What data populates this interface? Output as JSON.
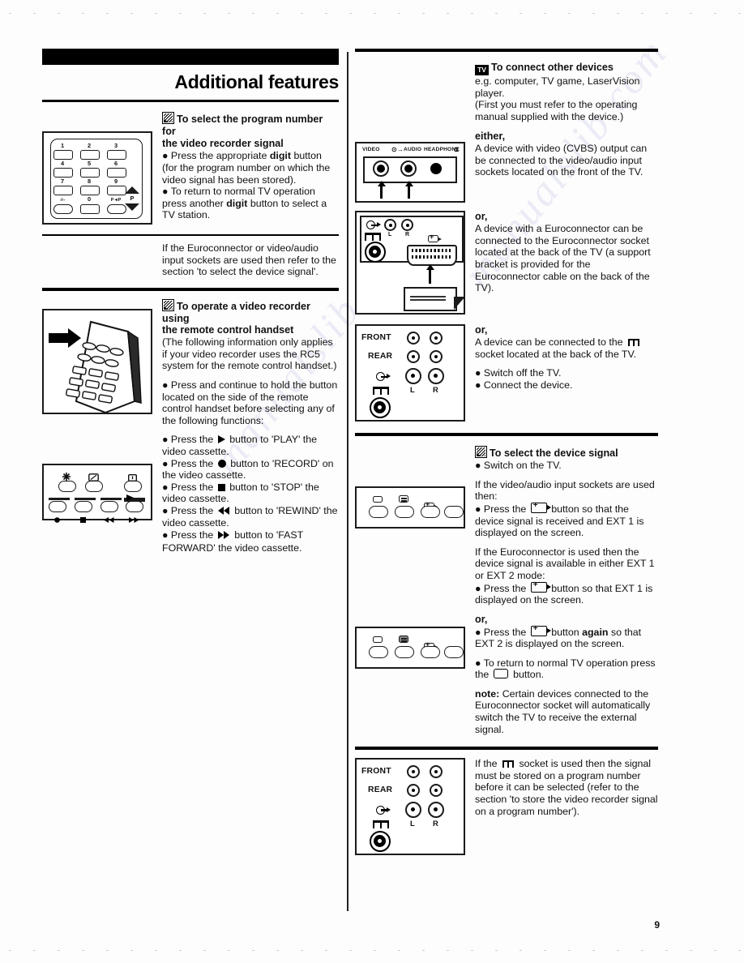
{
  "document": {
    "title": "Additional features",
    "page_number": "9"
  },
  "left_column": {
    "section_1": {
      "icon": "vcr-icon",
      "heading_line_1": "To select the program number for",
      "heading_line_2": "the video recorder signal",
      "paragraphs": [
        "● Press the appropriate digit button (for the program number on which the video signal has been stored).",
        "● To return to normal TV operation press another digit button to select a TV station."
      ],
      "figure": {
        "name": "remote-keypad-diagram",
        "keys": [
          "1",
          "2",
          "3",
          "4",
          "5",
          "6",
          "7",
          "8",
          "9",
          "-/--",
          "0",
          "P◄P"
        ],
        "p_label": "P",
        "up_arrow": "▲",
        "down_arrow": "▼"
      }
    },
    "note_1": {
      "text": "If the Euroconnector or video/audio input sockets are used then refer to the section 'to select the device signal'."
    },
    "section_2": {
      "icon": "vcr-icon",
      "heading_line_1": "To operate a video recorder using",
      "heading_line_2": "the remote control handset",
      "paragraphs": [
        "(The following information only applies if your video recorder uses the RC5 system for the remote control handset.)",
        "● Press and continue to hold the button located on the side of the remote control handset before selecting any of the following functions:"
      ],
      "bullets": [
        {
          "prefix": "● Press the",
          "glyph": "play",
          "suffix": "button to 'PLAY' the video cassette."
        },
        {
          "prefix": "● Press the",
          "glyph": "record",
          "suffix": "button to 'RECORD' on the video cassette."
        },
        {
          "prefix": "● Press the",
          "glyph": "stop",
          "suffix": "button to 'STOP' the video cassette."
        },
        {
          "prefix": "● Press the",
          "glyph": "rewind",
          "suffix": "button to 'REWIND' the video cassette."
        },
        {
          "prefix": "● Press the",
          "glyph": "fastforward",
          "suffix": "button to 'FAST FORWARD' the video cassette."
        }
      ],
      "figure_handset": {
        "name": "remote-handset-side-button-diagram"
      },
      "figure_buttons": {
        "name": "vcr-control-buttons-diagram",
        "top_icons": [
          "brightness-icon",
          "picture-icon",
          "info-icon"
        ],
        "bottom_icons": [
          "record-dot",
          "stop-square",
          "rewind-double",
          "fastforward-double"
        ],
        "play_marker": "▶"
      }
    }
  },
  "right_column": {
    "section_3": {
      "icon": "tv-icon",
      "icon_text": "TV",
      "heading": "To connect other devices",
      "paragraphs": [
        "e.g. computer, TV game, LaserVision player.",
        "(First you must refer to the operating manual supplied with the device.)"
      ],
      "either_label": "either,",
      "either_text": "A device with video (CVBS) output can be connected to the video/audio input sockets located on the front of the TV.",
      "figure_front": {
        "name": "front-socket-panel-diagram",
        "labels": [
          "VIDEO",
          "AUDIO",
          "HEADPHONE"
        ],
        "audio_symbol": "audio-in-icon",
        "headphone_symbol": "headphone-icon"
      },
      "or_label_1": "or,",
      "or_text_1": "A device with a Euroconnector can be connected to the Euroconnector socket located at the back of the TV (a support bracket is provided for the Euroconnector cable on the back of the TV).",
      "figure_euro": {
        "name": "euroconnector-socket-diagram",
        "labels": [
          "L",
          "R"
        ],
        "symbols": [
          "audio-out-icon",
          "aerial-icon",
          "euroconnector-icon"
        ]
      },
      "or_label_2": "or,",
      "or_text_2_part1": "A device can be connected to the",
      "or_text_2_glyph": "aerial-icon",
      "or_text_2_part2": "socket located at the back of the TV.",
      "steps": [
        "● Switch off the TV.",
        "● Connect the device."
      ],
      "figure_back_1": {
        "name": "back-panel-sockets-diagram",
        "row_labels": [
          "FRONT",
          "REAR"
        ],
        "channel_labels": [
          "L",
          "R"
        ],
        "symbols": [
          "audio-out-icon",
          "aerial-icon"
        ]
      }
    },
    "section_4": {
      "icon": "vcr-icon",
      "heading": "To select the device signal",
      "first_step": "● Switch on the TV.",
      "para_1": "If the video/audio input sockets are used then:",
      "step_ext1_pre": "● Press the",
      "step_ext1_post": "button so that the device signal is received and EXT 1 is displayed on the screen.",
      "para_2": "If the Euroconnector is used then the device signal is available in either EXT 1 or EXT 2 mode:",
      "step_ext1b_pre": "● Press the",
      "step_ext1b_post": "button so that EXT 1 is displayed on the screen.",
      "or_label": "or,",
      "step_ext2_pre": "● Press the",
      "step_ext2_mid": "button",
      "step_ext2_bold": "again",
      "step_ext2_post": "so that EXT 2 is displayed on the screen.",
      "step_return_pre": "● To return to normal TV operation press the",
      "step_return_post": "button.",
      "note_label": "note:",
      "note_text": "Certain devices connected to the Euroconnector socket will automatically switch the TV to receive the external signal.",
      "figure_ctrl_1": {
        "name": "tv-control-buttons-diagram-1",
        "icons": [
          "tv-button-icon",
          "menu-button-icon",
          "ext-button-icon",
          "store-button-icon"
        ]
      },
      "figure_ctrl_2": {
        "name": "tv-control-buttons-diagram-2",
        "icons": [
          "tv-button-icon",
          "menu-button-icon",
          "ext-button-icon",
          "store-button-icon"
        ]
      }
    },
    "section_5": {
      "text_part1": "If the",
      "glyph": "aerial-icon",
      "text_part2": "socket is used then the signal must be stored on a program number before it can be selected (refer to the section 'to store the video recorder signal on a program number').",
      "figure_back_2": {
        "name": "back-panel-sockets-diagram-2",
        "row_labels": [
          "FRONT",
          "REAR"
        ],
        "channel_labels": [
          "L",
          "R"
        ],
        "symbols": [
          "audio-out-icon",
          "aerial-icon"
        ]
      }
    }
  },
  "watermarks": [
    "manualslib.com",
    "manualslib.com"
  ]
}
